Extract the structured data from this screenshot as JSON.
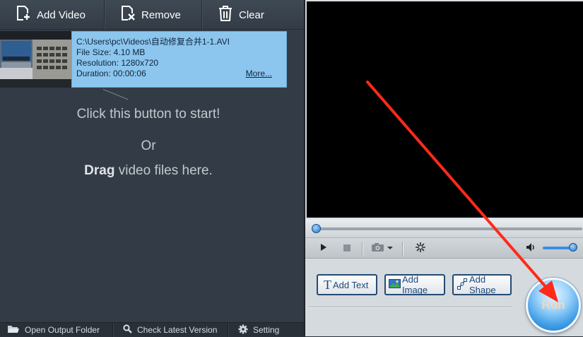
{
  "toolbar": {
    "add_video": "Add Video",
    "remove": "Remove",
    "clear": "Clear"
  },
  "file": {
    "path": "C:\\Users\\pc\\Videos\\自动修复合并1-1.AVI",
    "file_size": "File Size: 4.10 MB",
    "resolution": "Resolution: 1280x720",
    "duration": "Duration: 00:00:06",
    "more": "More..."
  },
  "hints": {
    "start": "Click this button to start!",
    "or": "Or",
    "drag_bold": "Drag",
    "drag_rest": " video files here."
  },
  "statusbar": {
    "open_output_folder": "Open Output Folder",
    "check_latest_version": "Check Latest Version",
    "setting": "Setting"
  },
  "player": {
    "seek_progress": 0.0,
    "volume_level": 0.9
  },
  "edit": {
    "add_text": "Add Text",
    "add_image": "Add Image",
    "add_shape": "Add Shape"
  },
  "run": {
    "label": "Run"
  },
  "colors": {
    "panel_dark": "#333c46",
    "file_selected": "#8cc6ee",
    "annotation_arrow": "#ff2a1a",
    "accent_blue": "#3b8de0"
  },
  "icons": {
    "add_video": "add-video-icon",
    "remove": "remove-icon",
    "clear": "trash-icon",
    "open_output_folder": "folder-icon",
    "check_latest_version": "search-icon",
    "setting": "gear-icon",
    "play": "play-icon",
    "stop": "stop-icon",
    "snapshot": "camera-icon",
    "effects": "sparkle-icon",
    "volume": "speaker-icon"
  }
}
